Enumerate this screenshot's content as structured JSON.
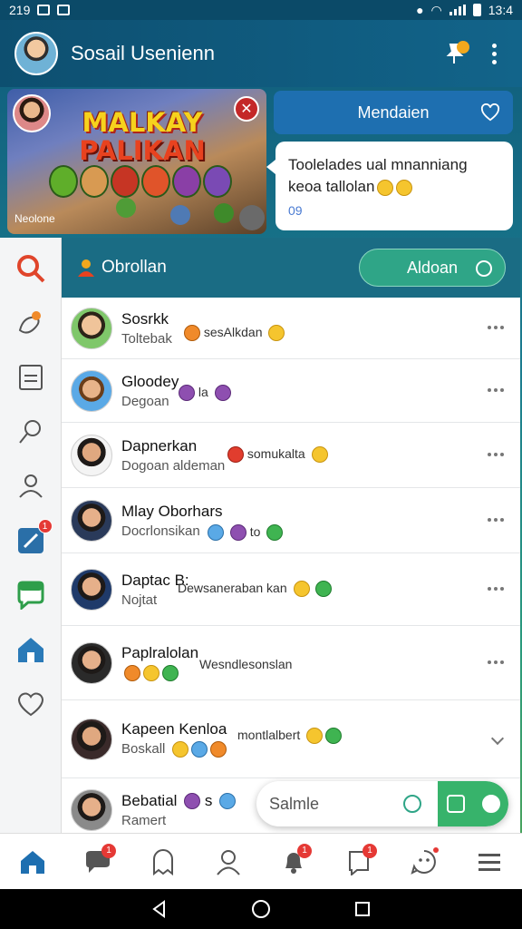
{
  "status_bar": {
    "time_left": "219",
    "time_right": "13:4"
  },
  "app_bar": {
    "title": "Sosail Usenienn"
  },
  "banner": {
    "game_title_line1": "MALKAY",
    "game_title_line2": "PALIKAN",
    "caption": "Neolone"
  },
  "panel": {
    "button_label": "Mendaien",
    "bubble_line1": "Toolelades ual mnanniang",
    "bubble_line2": "keoa tallolan",
    "bubble_meta": "09"
  },
  "chat_header": {
    "title": "Obrollan",
    "button_label": "Aldoan"
  },
  "chats": [
    {
      "name": "Sosrkk",
      "sub": "Toltebak",
      "msg": "sesAlkdan"
    },
    {
      "name": "Gloodey",
      "sub": "Degoan",
      "msg": "la"
    },
    {
      "name": "Dapnerkan",
      "sub": "Dogoan aldeman",
      "msg": "somukalta"
    },
    {
      "name": "Mlay Oborhars",
      "sub": "Docrlonsikan",
      "msg": "to"
    },
    {
      "name": "Daptac B:",
      "sub": "Nojtat",
      "msg": "Dewsaneraban kan"
    },
    {
      "name": "Paplralolan",
      "sub": "",
      "msg": "Wesndlesonslan"
    },
    {
      "name": "Kapeen Kenloa",
      "sub": "Boskall",
      "msg": "montlalbert"
    },
    {
      "name": "Bebatial",
      "sub": "Ramert",
      "msg": "s"
    }
  ],
  "search": {
    "placeholder": "Salmle"
  },
  "badges": {
    "rail_edit": "1",
    "nav_chat": "1",
    "nav_bell": "1",
    "nav_note": "1"
  },
  "colors": {
    "accent_teal": "#1a6c84",
    "accent_green": "#2fa587",
    "badge_red": "#e53935"
  }
}
